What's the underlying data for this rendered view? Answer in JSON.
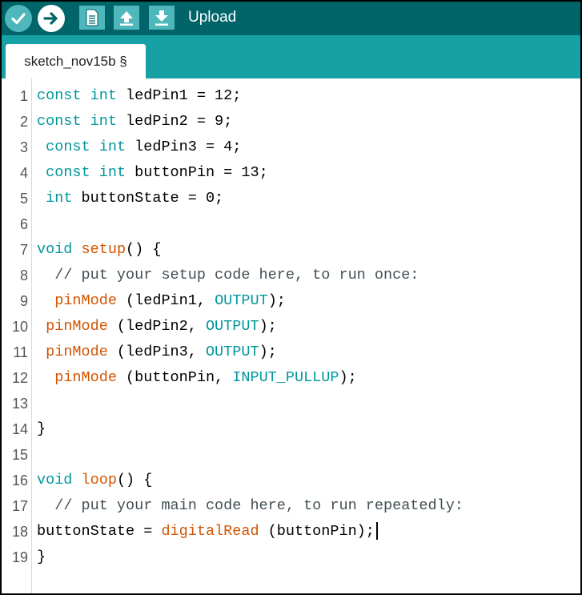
{
  "toolbar": {
    "buttons": [
      {
        "icon": "verify-check-icon",
        "label": ""
      },
      {
        "icon": "upload-arrow-icon",
        "label": ""
      },
      {
        "icon": "new-file-icon",
        "label": ""
      },
      {
        "icon": "open-up-arrow-icon",
        "label": ""
      },
      {
        "icon": "save-down-arrow-icon",
        "label": ""
      }
    ],
    "hover_label": "Upload"
  },
  "tab": {
    "label": "sketch_nov15b §"
  },
  "colors": {
    "toolbar_bg": "#006468",
    "tabbar_bg": "#17a1a5",
    "button_bg": "#4db7bb",
    "keyword": "#00979c",
    "function": "#d35400",
    "comment": "#434f54"
  },
  "code": {
    "lines": [
      {
        "n": "1",
        "indent": "",
        "tokens": [
          [
            "kw",
            "const"
          ],
          [
            "t",
            " "
          ],
          [
            "kw",
            "int"
          ],
          [
            "t",
            " ledPin1 = 12;"
          ]
        ]
      },
      {
        "n": "2",
        "indent": "",
        "tokens": [
          [
            "kw",
            "const"
          ],
          [
            "t",
            " "
          ],
          [
            "kw",
            "int"
          ],
          [
            "t",
            " ledPin2 = 9;"
          ]
        ]
      },
      {
        "n": "3",
        "indent": " ",
        "tokens": [
          [
            "kw",
            "const"
          ],
          [
            "t",
            " "
          ],
          [
            "kw",
            "int"
          ],
          [
            "t",
            " ledPin3 = 4;"
          ]
        ]
      },
      {
        "n": "4",
        "indent": " ",
        "tokens": [
          [
            "kw",
            "const"
          ],
          [
            "t",
            " "
          ],
          [
            "kw",
            "int"
          ],
          [
            "t",
            " buttonPin = 13;"
          ]
        ]
      },
      {
        "n": "5",
        "indent": " ",
        "tokens": [
          [
            "kw",
            "int"
          ],
          [
            "t",
            " buttonState = 0;"
          ]
        ]
      },
      {
        "n": "6",
        "indent": "",
        "tokens": []
      },
      {
        "n": "7",
        "indent": "",
        "tokens": [
          [
            "kw",
            "void"
          ],
          [
            "t",
            " "
          ],
          [
            "fn",
            "setup"
          ],
          [
            "t",
            "() {"
          ]
        ]
      },
      {
        "n": "8",
        "indent": "  ",
        "tokens": [
          [
            "cm",
            "// put your setup code here, to run once:"
          ]
        ]
      },
      {
        "n": "9",
        "indent": "  ",
        "tokens": [
          [
            "fn",
            "pinMode"
          ],
          [
            "t",
            " (ledPin1, "
          ],
          [
            "const",
            "OUTPUT"
          ],
          [
            "t",
            ");"
          ]
        ]
      },
      {
        "n": "10",
        "indent": " ",
        "tokens": [
          [
            "fn",
            "pinMode"
          ],
          [
            "t",
            " (ledPin2, "
          ],
          [
            "const",
            "OUTPUT"
          ],
          [
            "t",
            ");"
          ]
        ]
      },
      {
        "n": "11",
        "indent": " ",
        "tokens": [
          [
            "fn",
            "pinMode"
          ],
          [
            "t",
            " (ledPin3, "
          ],
          [
            "const",
            "OUTPUT"
          ],
          [
            "t",
            ");"
          ]
        ]
      },
      {
        "n": "12",
        "indent": "  ",
        "tokens": [
          [
            "fn",
            "pinMode"
          ],
          [
            "t",
            " (buttonPin, "
          ],
          [
            "const",
            "INPUT_PULLUP"
          ],
          [
            "t",
            ");"
          ]
        ]
      },
      {
        "n": "13",
        "indent": "",
        "tokens": []
      },
      {
        "n": "14",
        "indent": "",
        "tokens": [
          [
            "t",
            "}"
          ]
        ]
      },
      {
        "n": "15",
        "indent": "",
        "tokens": []
      },
      {
        "n": "16",
        "indent": "",
        "tokens": [
          [
            "kw",
            "void"
          ],
          [
            "t",
            " "
          ],
          [
            "fn",
            "loop"
          ],
          [
            "t",
            "() {"
          ]
        ]
      },
      {
        "n": "17",
        "indent": "  ",
        "tokens": [
          [
            "cm",
            "// put your main code here, to run repeatedly:"
          ]
        ]
      },
      {
        "n": "18",
        "indent": "",
        "tokens": [
          [
            "t",
            "buttonState = "
          ],
          [
            "fn",
            "digitalRead"
          ],
          [
            "t",
            " (buttonPin);"
          ]
        ],
        "cursor": true
      },
      {
        "n": "19",
        "indent": "",
        "tokens": [
          [
            "t",
            "}"
          ]
        ]
      }
    ]
  }
}
